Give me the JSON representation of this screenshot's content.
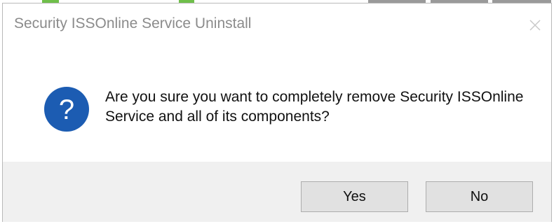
{
  "window": {
    "title": "Security ISSOnline Service Uninstall",
    "close_icon": "close-icon"
  },
  "message": {
    "icon": "question-icon",
    "icon_glyph": "?",
    "text": "Are you sure you want to completely remove Security ISSOnline Service and all of its components?"
  },
  "buttons": {
    "yes_label": "Yes",
    "no_label": "No"
  },
  "colors": {
    "icon_blue": "#1c5cb2",
    "footer_bg": "#f0f0f0",
    "button_bg": "#e1e1e1",
    "title_text": "#8b8b8b"
  }
}
